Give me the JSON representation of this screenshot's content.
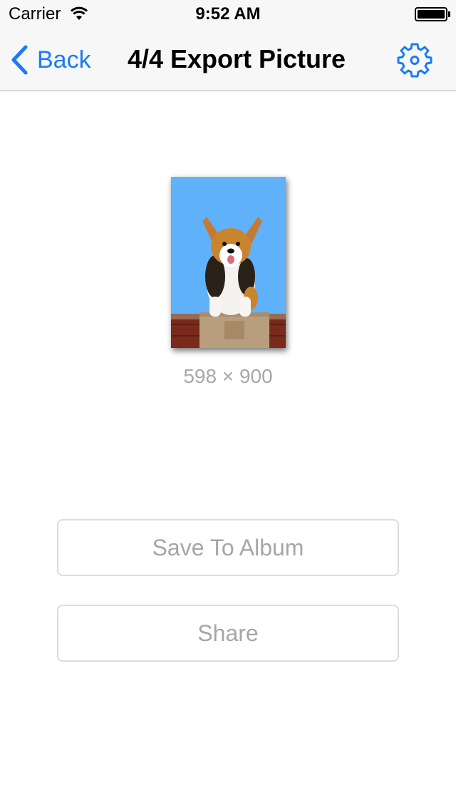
{
  "status_bar": {
    "carrier": "Carrier",
    "time": "9:52 AM"
  },
  "nav": {
    "back_label": "Back",
    "title": "4/4 Export Picture",
    "accent_color": "#1a7cf4"
  },
  "preview": {
    "dimensions": "598 × 900",
    "background_color": "#5fb2fa"
  },
  "actions": {
    "save_label": "Save To Album",
    "share_label": "Share"
  }
}
